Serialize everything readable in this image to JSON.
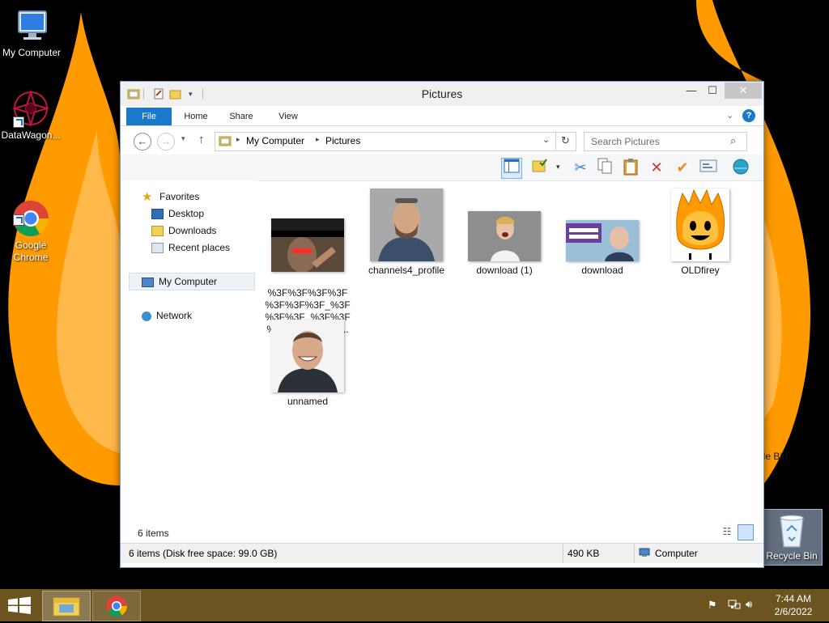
{
  "desktop": {
    "icons": [
      {
        "label": "My Computer"
      },
      {
        "label": "DataWagon..."
      },
      {
        "label": "Google\nChrome"
      }
    ],
    "recycle_bin": {
      "label": "Recycle Bin"
    },
    "ghost_menu_text": "Empty Recycle Bin"
  },
  "window": {
    "title": "Pictures",
    "ribbon_tabs": [
      "File",
      "Home",
      "Share",
      "View"
    ],
    "breadcrumb": [
      "My Computer",
      "Pictures"
    ],
    "search_placeholder": "Search Pictures",
    "nav": {
      "favorites": "Favorites",
      "favorites_items": [
        "Desktop",
        "Downloads",
        "Recent places"
      ],
      "my_computer": "My Computer",
      "network": "Network"
    },
    "files": [
      {
        "name": "%3F%3F%3F%3F\n%3F%3F%3F_%3F\n%3F%3F_%3F%3F\n%3F%3F%3F%3..."
      },
      {
        "name": "channels4_profile"
      },
      {
        "name": "download (1)"
      },
      {
        "name": "download"
      },
      {
        "name": "OLDfirey"
      },
      {
        "name": "unnamed"
      }
    ],
    "item_count": "6 items",
    "status_left": "6 items (Disk free space: 99.0 GB)",
    "status_size": "490 KB",
    "status_location": "Computer"
  },
  "taskbar": {
    "time": "7:44 AM",
    "date": "2/6/2022"
  },
  "colors": {
    "accent": "#1979ca",
    "taskbar": "#6b5420",
    "flame_outer": "#ff9a00",
    "flame_inner": "#ffb84a"
  }
}
